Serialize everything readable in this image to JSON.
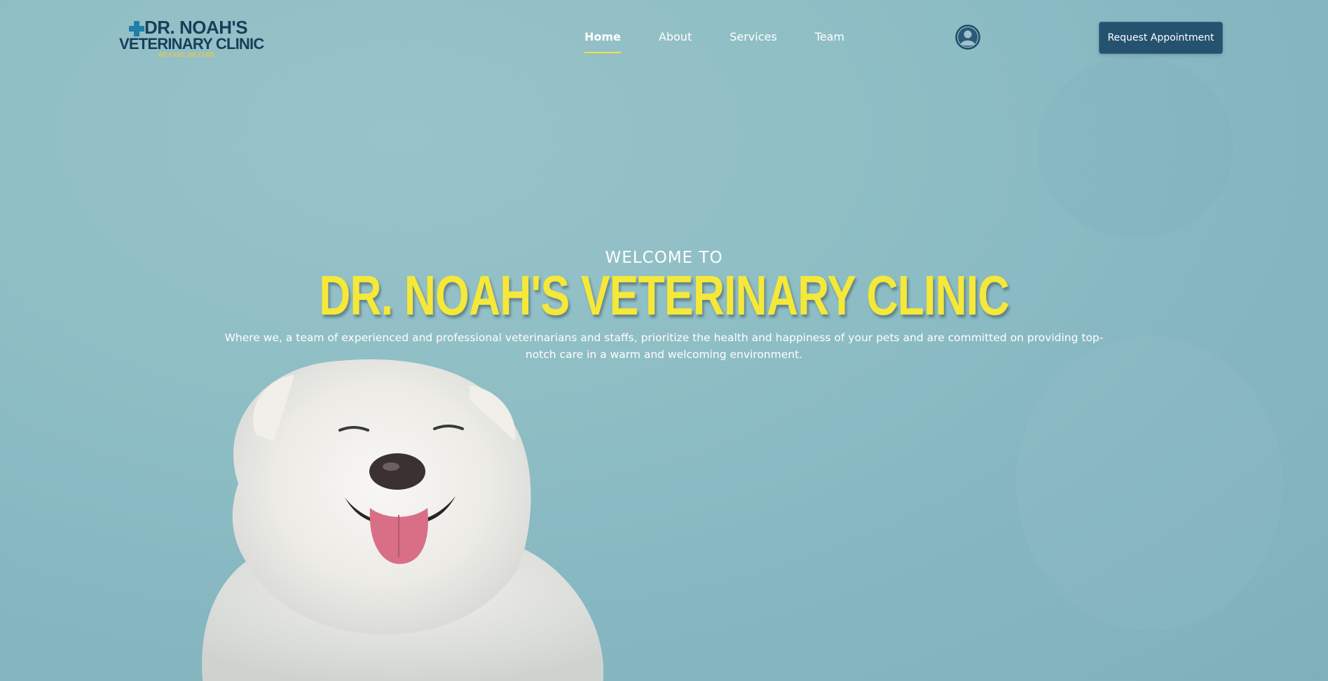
{
  "header": {
    "logo": {
      "line1": "DR. NOAH'S",
      "line2": "VETERINARY CLINIC",
      "tagline": "WE CARE, WE CURE",
      "icon": "medical-cross-icon"
    },
    "nav": [
      {
        "label": "Home",
        "active": true
      },
      {
        "label": "About",
        "active": false
      },
      {
        "label": "Services",
        "active": false
      },
      {
        "label": "Team",
        "active": false
      }
    ],
    "user_icon": "user-account-icon",
    "cta_label": "Request Appointment"
  },
  "hero": {
    "welcome": "WELCOME TO",
    "title": "DR. NOAH'S VETERINARY CLINIC",
    "description": "Where we, a team of experienced and professional veterinarians and staffs, prioritize the health and happiness of your pets and are committed on providing top-notch care in a warm and welcoming environment.",
    "image": "smiling-white-dog"
  },
  "colors": {
    "background": "#8fbec5",
    "title_yellow": "#f5e839",
    "nav_underline": "#f3e340",
    "cta_bg": "#25526f",
    "logo_navy": "#173f5a",
    "logo_tagline": "#e8c64a"
  }
}
